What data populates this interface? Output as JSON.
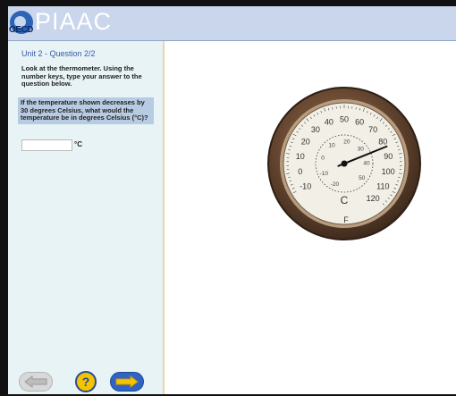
{
  "header": {
    "logo_small": "OECD",
    "logo_text": "PIAAC"
  },
  "sidebar": {
    "unit_label": "Unit 2 - Question 2/2",
    "instructions": "Look at the thermometer. Using the number keys, type your answer to the question below.",
    "question": "If the temperature shown decreases by 30 degrees Celsius, what would the temperature be in degrees Celsius (°C)?",
    "answer": {
      "value": "",
      "placeholder": ""
    },
    "answer_unit": "°C",
    "help_label": "?"
  },
  "thermometer": {
    "fahrenheit_ticks": [
      "-10",
      "0",
      "10",
      "20",
      "30",
      "40",
      "50",
      "60",
      "70",
      "80",
      "90",
      "100",
      "110",
      "120"
    ],
    "celsius_ticks": [
      "-20",
      "-10",
      "0",
      "10",
      "20",
      "30",
      "40",
      "50"
    ],
    "celsius_symbol": "C",
    "fahrenheit_symbol": "F",
    "reading_f": 84,
    "colors": {
      "rim": "#6b4a33",
      "face": "#f2efe6",
      "needle": "#111111"
    }
  }
}
